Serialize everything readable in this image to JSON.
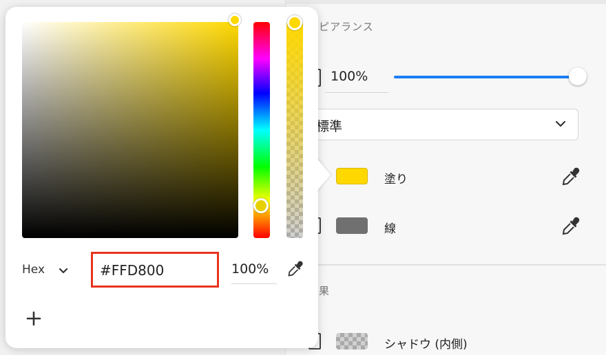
{
  "inspector": {
    "appearance_title": "アピアランス",
    "opacity_value": "100%",
    "opacity_level": 1.0,
    "blend_mode": "標準",
    "fill_label": "塗り",
    "fill_color": "#FFD800",
    "stroke_label": "線",
    "stroke_color": "#707070",
    "effects_title": "効果",
    "inner_shadow_label": "シャドウ (内側)"
  },
  "picker": {
    "mode": "Hex",
    "hex_value": "#FFD800",
    "alpha_value": "100%",
    "current_color": "#FFD800",
    "highlight_color": "#E8331D"
  }
}
